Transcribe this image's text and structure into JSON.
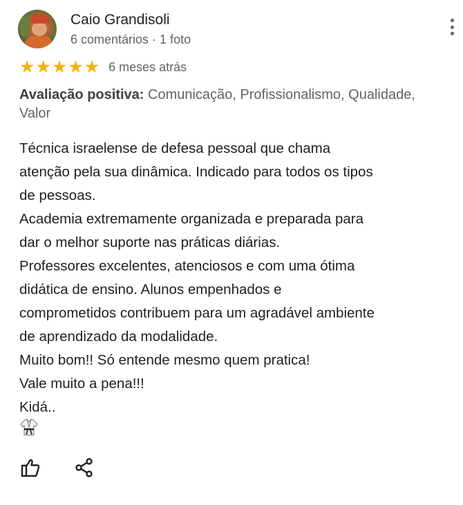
{
  "author": {
    "name": "Caio Grandisoli",
    "meta": "6 comentários · 1 foto"
  },
  "rating": {
    "stars": 5,
    "star_glyph": "★",
    "time_ago": "6 meses atrás",
    "star_color": "#f4b400"
  },
  "highlights": {
    "label": "Avaliação positiva:",
    "values": "Comunicação, Profissionalismo, Qualidade, Valor"
  },
  "review": {
    "lines": [
      "Técnica israelense de defesa pessoal que chama",
      "atenção pela sua dinâmica. Indicado para todos os tipos",
      "de pessoas.",
      "Academia extremamente organizada e preparada para",
      "dar o melhor suporte nas práticas diárias.",
      "Professores excelentes, atenciosos e com uma ótima",
      "didática de ensino. Alunos empenhados e",
      "comprometidos contribuem para um agradável ambiente",
      "de aprendizado da modalidade.",
      "Muito bom!! Só entende mesmo quem pratica!",
      "Vale muito a pena!!!",
      "Kidá.."
    ],
    "emoji_icon": "martial-arts-uniform-icon"
  },
  "actions": {
    "like_icon": "thumbs-up-icon",
    "share_icon": "share-icon"
  }
}
